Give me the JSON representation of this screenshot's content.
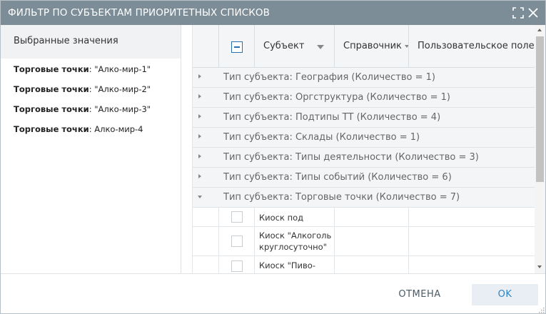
{
  "dialog": {
    "title": "ФИЛЬТР ПО СУБЪЕКТАМ ПРИОРИТЕТНЫХ СПИСКОВ"
  },
  "left_panel": {
    "header": "Выбранные значения",
    "items": [
      {
        "label": "Торговые точки",
        "value": ": \"Алко-мир-1\""
      },
      {
        "label": "Торговые точки",
        "value": ": \"Алко-мир-2\""
      },
      {
        "label": "Торговые точки",
        "value": ": \"Алко-мир-3\""
      },
      {
        "label": "Торговые точки",
        "value": ": Алко-мир-4"
      }
    ]
  },
  "grid": {
    "columns": [
      {
        "label": "Субъект"
      },
      {
        "label": "Справочник"
      },
      {
        "label": "Пользовательское поле"
      }
    ],
    "groups": [
      {
        "text": "Тип субъекта: География (Количество = 1)",
        "expanded": false
      },
      {
        "text": "Тип субъекта: Оргструктура (Количество = 1)",
        "expanded": false
      },
      {
        "text": "Тип субъекта: Подтипы ТТ (Количество = 4)",
        "expanded": false
      },
      {
        "text": "Тип субъекта: Склады (Количество = 1)",
        "expanded": false
      },
      {
        "text": "Тип субъекта: Типы деятельности (Количество = 3)",
        "expanded": false
      },
      {
        "text": "Тип субъекта: Типы событий (Количество = 6)",
        "expanded": false
      },
      {
        "text": "Тип субъекта: Торговые точки (Количество = 7)",
        "expanded": true
      }
    ],
    "rows": [
      {
        "line1": "Киоск под домом",
        "line2": ""
      },
      {
        "line1": "Киоск \"Алкоголь",
        "line2": "круглосуточно\""
      },
      {
        "line1": "Киоск \"Пиво-рак\"",
        "line2": ""
      }
    ]
  },
  "footer": {
    "cancel_label": "ОТМЕНА",
    "ok_label": "OK"
  },
  "colors": {
    "titlebar": "#7c8d98",
    "accent": "#2f83c6"
  }
}
